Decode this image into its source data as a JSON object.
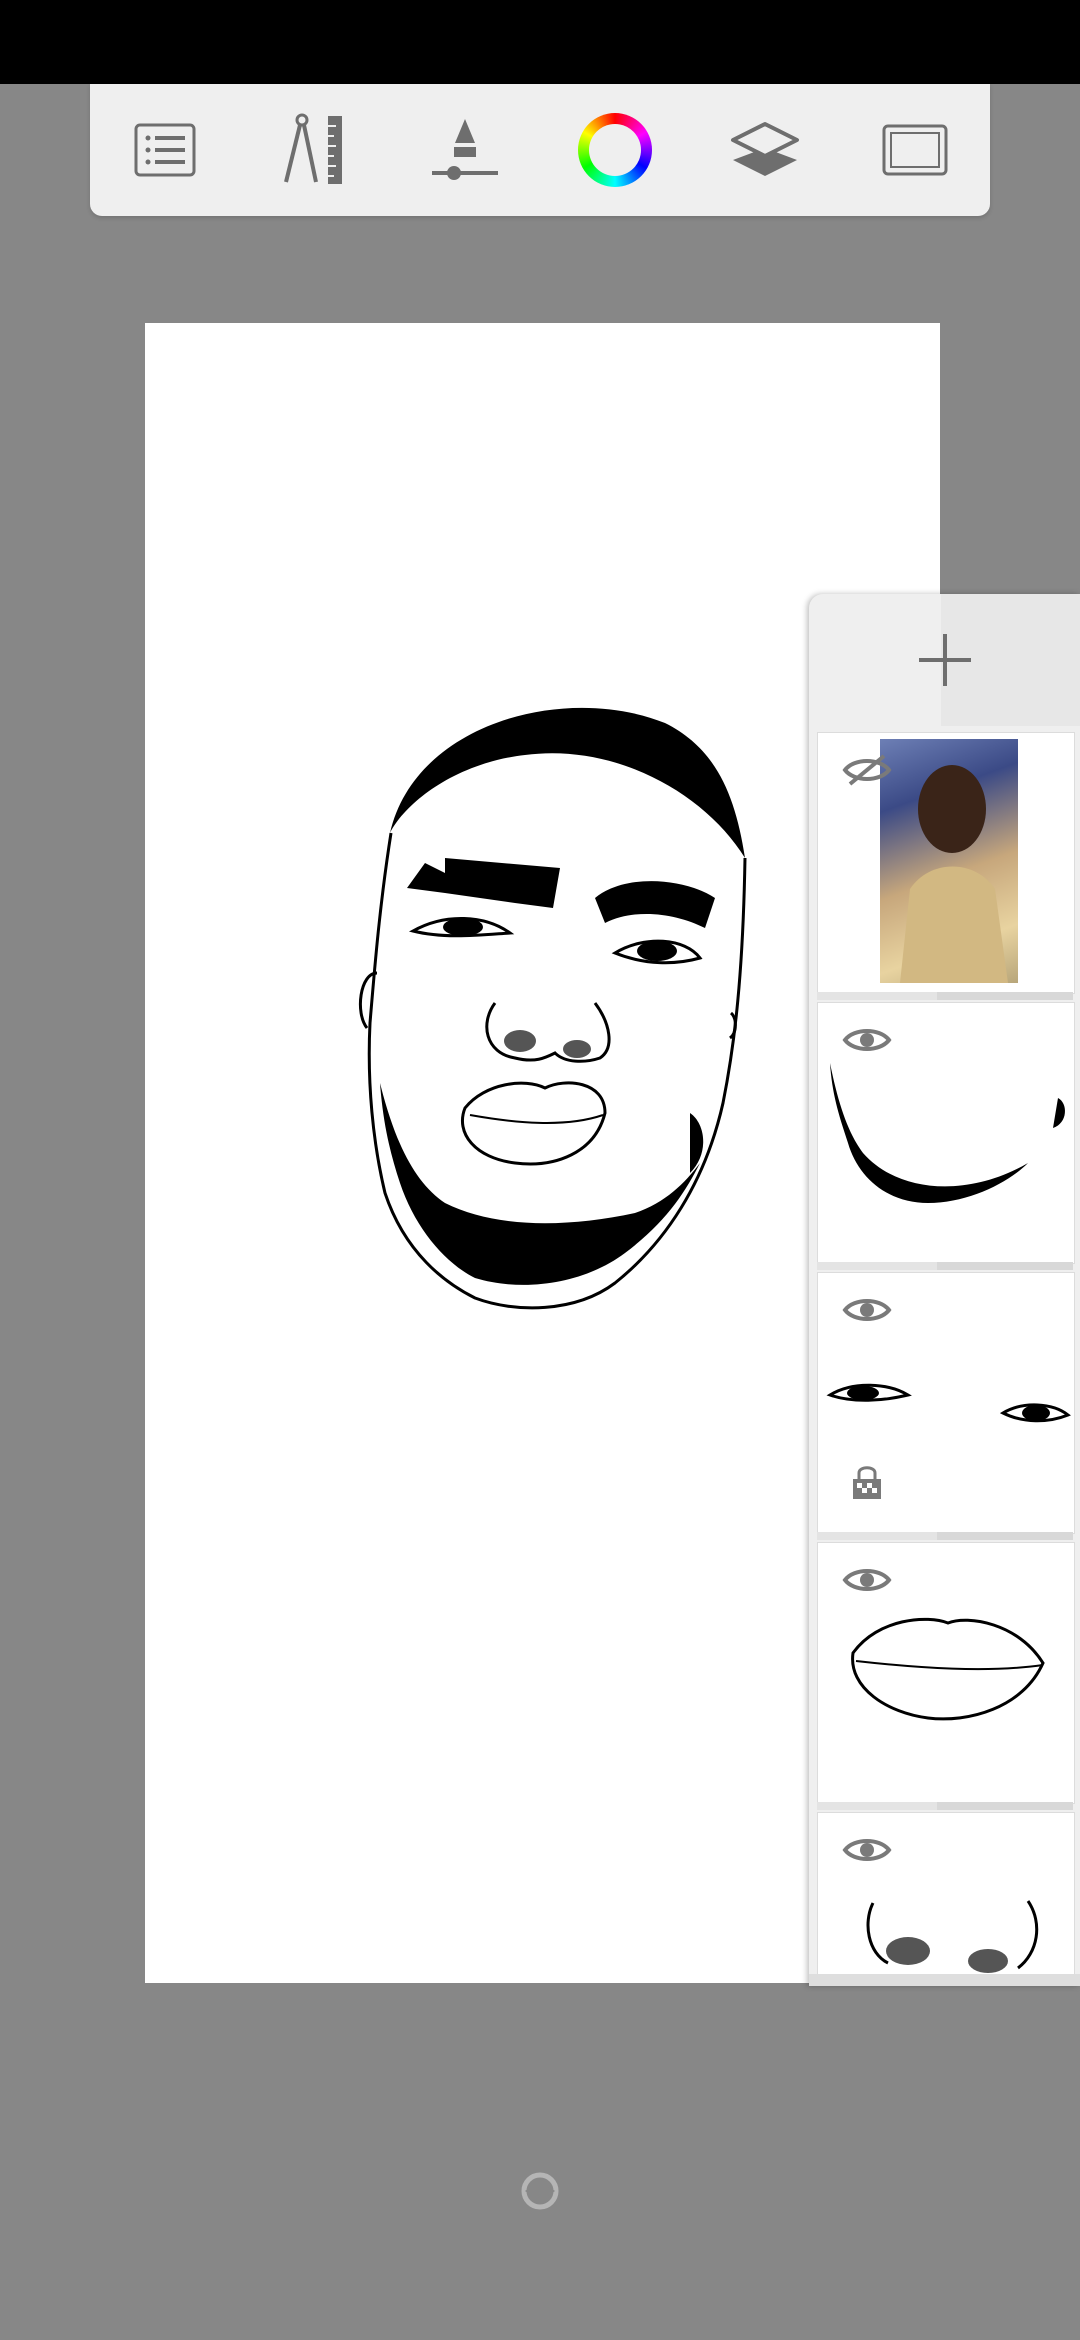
{
  "app": {
    "colors": {
      "background": "#878787",
      "toolbar": "#efefef",
      "icon": "#6e6e6e",
      "canvas": "#ffffff"
    }
  },
  "toolbar": {
    "items": [
      {
        "icon": "list-icon"
      },
      {
        "icon": "ruler-compass-icon"
      },
      {
        "icon": "brush-size-icon"
      },
      {
        "icon": "color-wheel-icon"
      },
      {
        "icon": "layers-icon"
      },
      {
        "icon": "canvas-frame-icon"
      }
    ]
  },
  "layers_panel": {
    "add_icon": "plus-icon",
    "layers": [
      {
        "name": "photo-reference",
        "visible": false
      },
      {
        "name": "beard",
        "visible": true
      },
      {
        "name": "eyes",
        "visible": true,
        "alpha_locked": true
      },
      {
        "name": "lips",
        "visible": true
      },
      {
        "name": "nose",
        "visible": true
      }
    ]
  },
  "footer": {
    "icon": "sync-icon"
  }
}
